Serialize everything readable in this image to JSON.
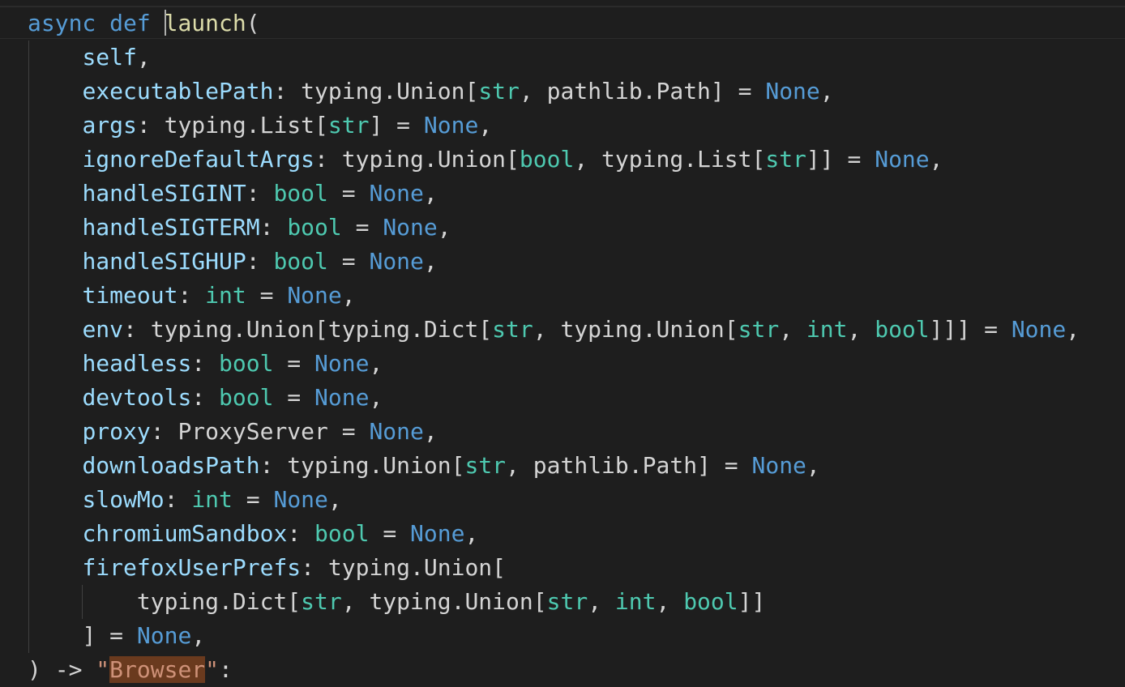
{
  "editor": {
    "lines": [
      {
        "indent": 0,
        "tokens": [
          {
            "t": "async",
            "k": "kw"
          },
          {
            "t": " ",
            "k": "punc"
          },
          {
            "t": "def",
            "k": "kw"
          },
          {
            "t": " ",
            "k": "punc"
          },
          {
            "t": "",
            "k": "cursor"
          },
          {
            "t": "launch",
            "k": "fn"
          },
          {
            "t": "(",
            "k": "punc"
          }
        ]
      },
      {
        "indent": 1,
        "tokens": [
          {
            "t": "self",
            "k": "param"
          },
          {
            "t": ",",
            "k": "punc"
          }
        ]
      },
      {
        "indent": 1,
        "tokens": [
          {
            "t": "executablePath",
            "k": "param"
          },
          {
            "t": ": typing.Union[",
            "k": "punc"
          },
          {
            "t": "str",
            "k": "type"
          },
          {
            "t": ", pathlib.Path] = ",
            "k": "punc"
          },
          {
            "t": "None",
            "k": "const"
          },
          {
            "t": ",",
            "k": "punc"
          }
        ]
      },
      {
        "indent": 1,
        "tokens": [
          {
            "t": "args",
            "k": "param"
          },
          {
            "t": ": typing.List[",
            "k": "punc"
          },
          {
            "t": "str",
            "k": "type"
          },
          {
            "t": "] = ",
            "k": "punc"
          },
          {
            "t": "None",
            "k": "const"
          },
          {
            "t": ",",
            "k": "punc"
          }
        ]
      },
      {
        "indent": 1,
        "tokens": [
          {
            "t": "ignoreDefaultArgs",
            "k": "param"
          },
          {
            "t": ": typing.Union[",
            "k": "punc"
          },
          {
            "t": "bool",
            "k": "type"
          },
          {
            "t": ", typing.List[",
            "k": "punc"
          },
          {
            "t": "str",
            "k": "type"
          },
          {
            "t": "]] = ",
            "k": "punc"
          },
          {
            "t": "None",
            "k": "const"
          },
          {
            "t": ",",
            "k": "punc"
          }
        ]
      },
      {
        "indent": 1,
        "tokens": [
          {
            "t": "handleSIGINT",
            "k": "param"
          },
          {
            "t": ": ",
            "k": "punc"
          },
          {
            "t": "bool",
            "k": "type"
          },
          {
            "t": " = ",
            "k": "punc"
          },
          {
            "t": "None",
            "k": "const"
          },
          {
            "t": ",",
            "k": "punc"
          }
        ]
      },
      {
        "indent": 1,
        "tokens": [
          {
            "t": "handleSIGTERM",
            "k": "param"
          },
          {
            "t": ": ",
            "k": "punc"
          },
          {
            "t": "bool",
            "k": "type"
          },
          {
            "t": " = ",
            "k": "punc"
          },
          {
            "t": "None",
            "k": "const"
          },
          {
            "t": ",",
            "k": "punc"
          }
        ]
      },
      {
        "indent": 1,
        "tokens": [
          {
            "t": "handleSIGHUP",
            "k": "param"
          },
          {
            "t": ": ",
            "k": "punc"
          },
          {
            "t": "bool",
            "k": "type"
          },
          {
            "t": " = ",
            "k": "punc"
          },
          {
            "t": "None",
            "k": "const"
          },
          {
            "t": ",",
            "k": "punc"
          }
        ]
      },
      {
        "indent": 1,
        "tokens": [
          {
            "t": "timeout",
            "k": "param"
          },
          {
            "t": ": ",
            "k": "punc"
          },
          {
            "t": "int",
            "k": "type"
          },
          {
            "t": " = ",
            "k": "punc"
          },
          {
            "t": "None",
            "k": "const"
          },
          {
            "t": ",",
            "k": "punc"
          }
        ]
      },
      {
        "indent": 1,
        "tokens": [
          {
            "t": "env",
            "k": "param"
          },
          {
            "t": ": typing.Union[typing.Dict[",
            "k": "punc"
          },
          {
            "t": "str",
            "k": "type"
          },
          {
            "t": ", typing.Union[",
            "k": "punc"
          },
          {
            "t": "str",
            "k": "type"
          },
          {
            "t": ", ",
            "k": "punc"
          },
          {
            "t": "int",
            "k": "type"
          },
          {
            "t": ", ",
            "k": "punc"
          },
          {
            "t": "bool",
            "k": "type"
          },
          {
            "t": "]]] = ",
            "k": "punc"
          },
          {
            "t": "None",
            "k": "const"
          },
          {
            "t": ",",
            "k": "punc"
          }
        ]
      },
      {
        "indent": 1,
        "tokens": [
          {
            "t": "headless",
            "k": "param"
          },
          {
            "t": ": ",
            "k": "punc"
          },
          {
            "t": "bool",
            "k": "type"
          },
          {
            "t": " = ",
            "k": "punc"
          },
          {
            "t": "None",
            "k": "const"
          },
          {
            "t": ",",
            "k": "punc"
          }
        ]
      },
      {
        "indent": 1,
        "tokens": [
          {
            "t": "devtools",
            "k": "param"
          },
          {
            "t": ": ",
            "k": "punc"
          },
          {
            "t": "bool",
            "k": "type"
          },
          {
            "t": " = ",
            "k": "punc"
          },
          {
            "t": "None",
            "k": "const"
          },
          {
            "t": ",",
            "k": "punc"
          }
        ]
      },
      {
        "indent": 1,
        "tokens": [
          {
            "t": "proxy",
            "k": "param"
          },
          {
            "t": ": ProxyServer = ",
            "k": "punc"
          },
          {
            "t": "None",
            "k": "const"
          },
          {
            "t": ",",
            "k": "punc"
          }
        ]
      },
      {
        "indent": 1,
        "tokens": [
          {
            "t": "downloadsPath",
            "k": "param"
          },
          {
            "t": ": typing.Union[",
            "k": "punc"
          },
          {
            "t": "str",
            "k": "type"
          },
          {
            "t": ", pathlib.Path] = ",
            "k": "punc"
          },
          {
            "t": "None",
            "k": "const"
          },
          {
            "t": ",",
            "k": "punc"
          }
        ]
      },
      {
        "indent": 1,
        "tokens": [
          {
            "t": "slowMo",
            "k": "param"
          },
          {
            "t": ": ",
            "k": "punc"
          },
          {
            "t": "int",
            "k": "type"
          },
          {
            "t": " = ",
            "k": "punc"
          },
          {
            "t": "None",
            "k": "const"
          },
          {
            "t": ",",
            "k": "punc"
          }
        ]
      },
      {
        "indent": 1,
        "tokens": [
          {
            "t": "chromiumSandbox",
            "k": "param"
          },
          {
            "t": ": ",
            "k": "punc"
          },
          {
            "t": "bool",
            "k": "type"
          },
          {
            "t": " = ",
            "k": "punc"
          },
          {
            "t": "None",
            "k": "const"
          },
          {
            "t": ",",
            "k": "punc"
          }
        ]
      },
      {
        "indent": 1,
        "tokens": [
          {
            "t": "firefoxUserPrefs",
            "k": "param"
          },
          {
            "t": ": typing.Union[",
            "k": "punc"
          }
        ]
      },
      {
        "indent": 2,
        "tokens": [
          {
            "t": "typing.Dict[",
            "k": "punc"
          },
          {
            "t": "str",
            "k": "type"
          },
          {
            "t": ", typing.Union[",
            "k": "punc"
          },
          {
            "t": "str",
            "k": "type"
          },
          {
            "t": ", ",
            "k": "punc"
          },
          {
            "t": "int",
            "k": "type"
          },
          {
            "t": ", ",
            "k": "punc"
          },
          {
            "t": "bool",
            "k": "type"
          },
          {
            "t": "]]",
            "k": "punc"
          }
        ]
      },
      {
        "indent": 1,
        "tokens": [
          {
            "t": "] = ",
            "k": "punc"
          },
          {
            "t": "None",
            "k": "const"
          },
          {
            "t": ",",
            "k": "punc"
          }
        ]
      },
      {
        "indent": 0,
        "tokens": [
          {
            "t": ") -> ",
            "k": "punc"
          },
          {
            "t": "\"",
            "k": "str"
          },
          {
            "t": "Browser",
            "k": "hl"
          },
          {
            "t": "\"",
            "k": "str"
          },
          {
            "t": ":",
            "k": "punc"
          }
        ]
      }
    ]
  }
}
